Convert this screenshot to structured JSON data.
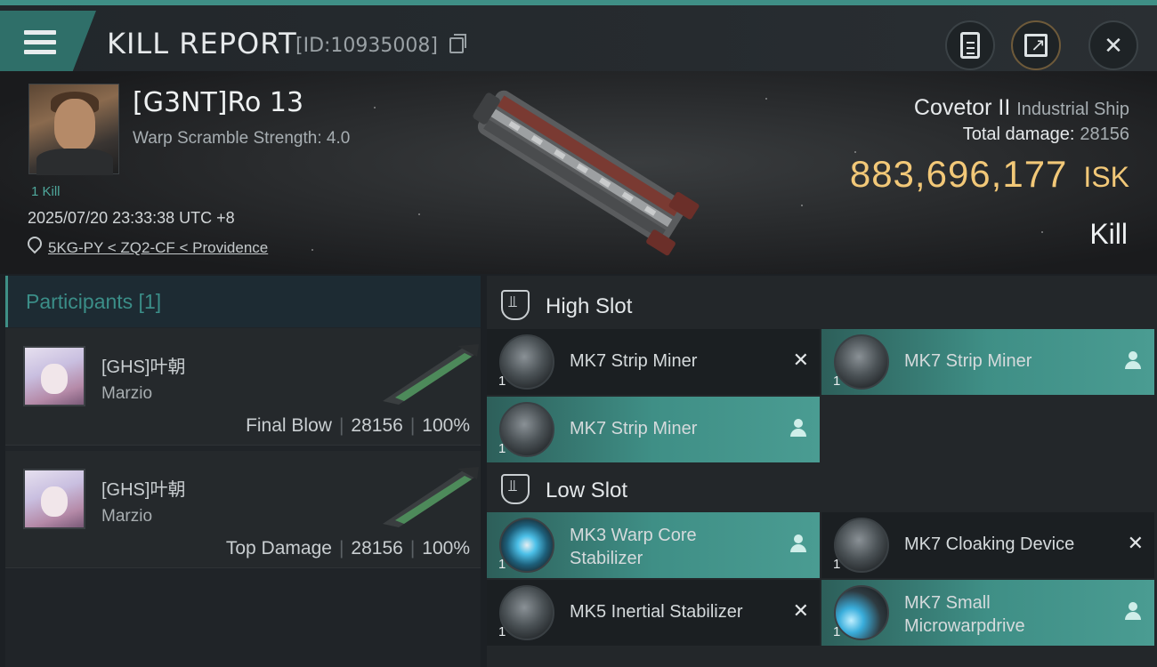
{
  "header": {
    "title": "KILL REPORT",
    "report_id": "[ID:10935008]",
    "menu_icon": "hamburger-icon",
    "buttons": [
      {
        "name": "clipboard-icon"
      },
      {
        "name": "export-icon"
      },
      {
        "name": "close-icon",
        "symbol": "✕"
      }
    ]
  },
  "victim": {
    "name": "[G3NT]Ro 13",
    "warp_scramble": "Warp Scramble Strength: 4.0",
    "kills": "1 Kill",
    "datetime": "2025/07/20 23:33:38 UTC +8",
    "location": "5KG-PY < ZQ2-CF < Providence"
  },
  "ship": {
    "name": "Covetor II",
    "class": "Industrial Ship",
    "total_damage_label": "Total damage:",
    "total_damage": "28156",
    "isk_value": "883,696,177",
    "isk_unit": "ISK",
    "result": "Kill"
  },
  "participants": {
    "header": "Participants [1]",
    "rows": [
      {
        "name": "[GHS]叶朝",
        "corp": "Marzio",
        "role": "Final Blow",
        "damage": "28156",
        "percent": "100%",
        "sep": "|"
      },
      {
        "name": "[GHS]叶朝",
        "corp": "Marzio",
        "role": "Top Damage",
        "damage": "28156",
        "percent": "100%",
        "sep": "|"
      }
    ]
  },
  "slots": {
    "high": {
      "label": "High Slot",
      "modules": [
        {
          "name": "MK7 Strip Miner",
          "qty": "1",
          "status": "destroyed",
          "symbol": "✕"
        },
        {
          "name": "MK7 Strip Miner",
          "qty": "1",
          "status": "dropped"
        },
        {
          "name": "MK7 Strip Miner",
          "qty": "1",
          "status": "dropped"
        }
      ]
    },
    "low": {
      "label": "Low Slot",
      "modules": [
        {
          "name": "MK3 Warp Core Stabilizer",
          "line1": "MK3 Warp Core",
          "line2": "Stabilizer",
          "qty": "1",
          "status": "dropped"
        },
        {
          "name": "MK7 Cloaking Device",
          "qty": "1",
          "status": "destroyed",
          "symbol": "✕"
        },
        {
          "name": "MK5 Inertial Stabilizer",
          "qty": "1",
          "status": "destroyed",
          "symbol": "✕"
        },
        {
          "name": "MK7 Small Microwarpdrive",
          "line1": "MK7 Small",
          "line2": "Microwarpdrive",
          "qty": "1",
          "status": "dropped"
        }
      ]
    }
  },
  "colors": {
    "accent": "#3f8f86",
    "isk": "#f2c878",
    "background": "#1c2024"
  }
}
